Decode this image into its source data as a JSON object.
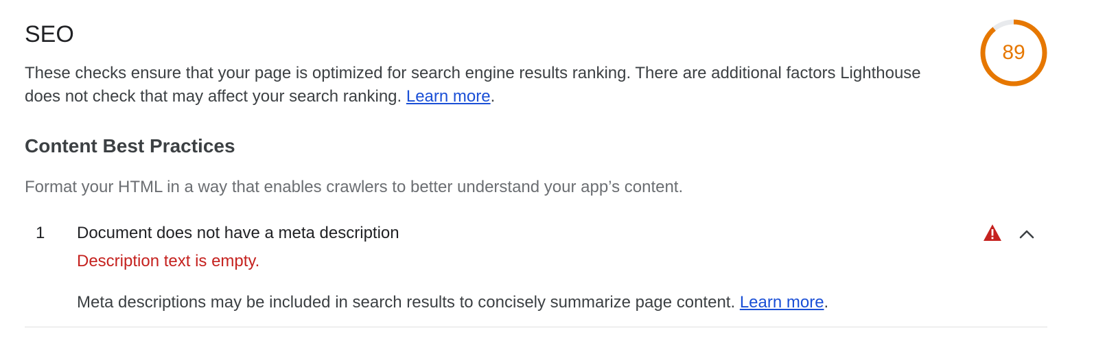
{
  "category": {
    "title": "SEO",
    "description_text": "These checks ensure that your page is optimized for search engine results ranking. There are additional factors Lighthouse does not check that may affect your search ranking. ",
    "learn_more": "Learn more",
    "period": "."
  },
  "gauge": {
    "score": "89",
    "score_fraction": 0.89,
    "color": "#e67700",
    "track_color": "#e8eaed"
  },
  "group": {
    "title": "Content Best Practices",
    "description": "Format your HTML in a way that enables crawlers to better understand your app’s content."
  },
  "audit": {
    "index": "1",
    "title": "Document does not have a meta description",
    "explanation": "Description text is empty.",
    "detail_text": "Meta descriptions may be included in search results to concisely summarize page content. ",
    "learn_more": "Learn more",
    "period": ".",
    "status_icon": "warning-triangle-icon",
    "expand_icon": "chevron-up-icon",
    "fail_color": "#c5221f"
  }
}
